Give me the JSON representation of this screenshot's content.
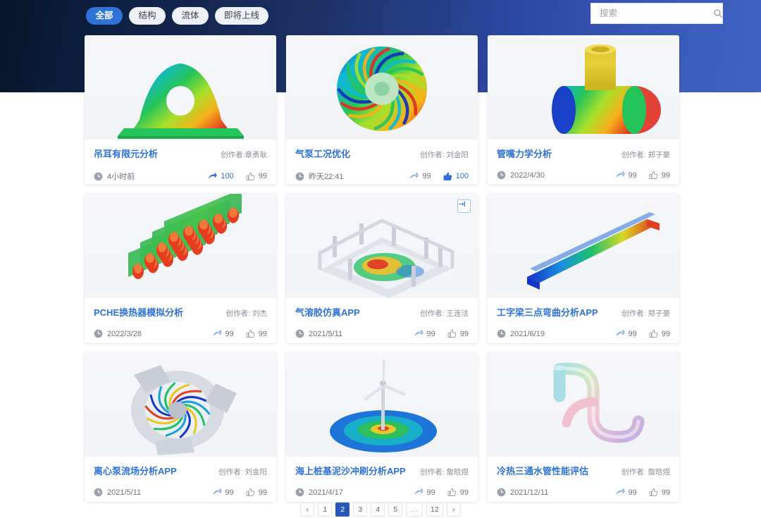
{
  "filters": [
    {
      "label": "全部",
      "active": true
    },
    {
      "label": "结构",
      "active": false
    },
    {
      "label": "流体",
      "active": false
    },
    {
      "label": "即将上线",
      "active": false
    }
  ],
  "search": {
    "placeholder": "搜索",
    "value": "",
    "icon": "search-icon"
  },
  "colors": {
    "accent": "#2f73d8",
    "pager_active": "#2859b8",
    "chip_active": "#2f73d8",
    "banner_dark": "#061529",
    "banner_light": "#3f62c4",
    "muted_text": "#6d737c",
    "author_text": "#8a9099"
  },
  "cards": [
    {
      "title": "吊耳有限元分析",
      "author": "创作者:章勇耿",
      "date": "4小时前",
      "shares": "100",
      "likes": "99",
      "share_highlight": true,
      "like_highlight": false,
      "has_open_button": false,
      "thumb": "lifting-lug-fea"
    },
    {
      "title": "气泵工况优化",
      "author": "创作者: 刘金阳",
      "date": "昨天22:41",
      "shares": "99",
      "likes": "100",
      "share_highlight": false,
      "like_highlight": true,
      "has_open_button": false,
      "thumb": "pump-impeller-cfd"
    },
    {
      "title": "管嘴力学分析",
      "author": "创作者: 郑子豪",
      "date": "2022/4/30",
      "shares": "99",
      "likes": "99",
      "share_highlight": false,
      "like_highlight": false,
      "has_open_button": false,
      "thumb": "nozzle-stress"
    },
    {
      "title": "PCHE换热器模拟分析",
      "author": "创作者: 刘杰",
      "date": "2022/3/28",
      "shares": "99",
      "likes": "99",
      "share_highlight": false,
      "like_highlight": false,
      "has_open_button": false,
      "thumb": "pche-heat-exchanger"
    },
    {
      "title": "气溶胶仿真APP",
      "author": "创作者: 王连法",
      "date": "2021/5/11",
      "shares": "99",
      "likes": "99",
      "share_highlight": false,
      "like_highlight": false,
      "has_open_button": true,
      "thumb": "aerosol-room-sim"
    },
    {
      "title": "工字梁三点弯曲分析APP",
      "author": "创作者: 郑子豪",
      "date": "2021/6/19",
      "shares": "99",
      "likes": "99",
      "share_highlight": false,
      "like_highlight": false,
      "has_open_button": false,
      "thumb": "i-beam-bending"
    },
    {
      "title": "离心泵流场分析APP",
      "author": "创作者: 刘金阳",
      "date": "2021/5/11",
      "shares": "99",
      "likes": "99",
      "share_highlight": false,
      "like_highlight": false,
      "has_open_button": false,
      "thumb": "centrifugal-pump-flow"
    },
    {
      "title": "海上桩基泥沙冲刷分析APP",
      "author": "创作者: 詹晗煜",
      "date": "2021/4/17",
      "shares": "99",
      "likes": "99",
      "share_highlight": false,
      "like_highlight": false,
      "has_open_button": false,
      "thumb": "offshore-scour"
    },
    {
      "title": "冷热三通水管性能评估",
      "author": "创作者: 詹晗煜",
      "date": "2021/12/11",
      "shares": "99",
      "likes": "99",
      "share_highlight": false,
      "like_highlight": false,
      "has_open_button": false,
      "thumb": "hot-cold-tee-pipe"
    }
  ],
  "pagination": {
    "prev": "‹",
    "next": "›",
    "ellipsis": "...",
    "pages": [
      "1",
      "2",
      "3",
      "4",
      "5",
      "...",
      "12"
    ],
    "current": "2"
  }
}
